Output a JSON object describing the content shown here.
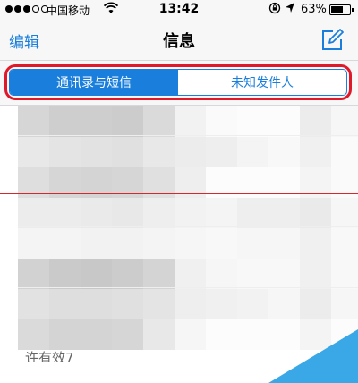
{
  "status_bar": {
    "carrier": "中国移动",
    "time": "13:42",
    "battery_percent_label": "63%",
    "battery_level": 0.63,
    "icons": [
      "signal-dots",
      "wifi-icon",
      "rotation-lock-icon",
      "location-arrow-icon",
      "battery-icon"
    ]
  },
  "nav": {
    "edit_label": "编辑",
    "title": "信息",
    "compose_icon": "compose-icon"
  },
  "segment": {
    "items": [
      {
        "label": "通讯录与短信",
        "selected": true
      },
      {
        "label": "未知发件人",
        "selected": false
      }
    ]
  },
  "content": {
    "bottom_snippet": "许有效7"
  },
  "colors": {
    "accent": "#1a7fdc",
    "highlight": "#e0192a",
    "bar_bg": "#f7f7f8",
    "corner": "#3aa7e6"
  }
}
